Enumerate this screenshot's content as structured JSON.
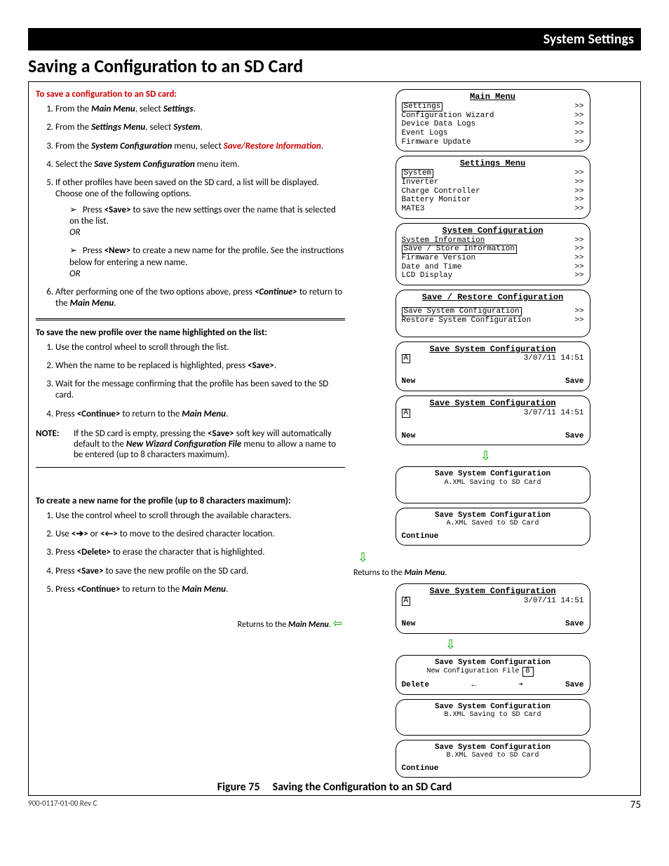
{
  "header": {
    "section": "System Settings"
  },
  "title": "Saving a Configuration to an SD Card",
  "sec1": {
    "heading": "To save a configuration to an SD card:",
    "s1a": "From the ",
    "s1b": "Main Menu",
    "s1c": ", select ",
    "s1d": "Settings",
    "s1e": ".",
    "s2a": "From the ",
    "s2b": "Settings Menu",
    "s2c": ", select ",
    "s2d": "System",
    "s2e": ".",
    "s3a": "From the ",
    "s3b": "System Configuration",
    "s3c": " menu, select ",
    "s3d": "Save/Restore Information",
    "s3e": ".",
    "s4a": "Select the ",
    "s4b": "Save System Configuration",
    "s4c": " menu item.",
    "s5": "If other profiles have been saved on the SD card, a list will be displayed.  Choose one of the following options.",
    "s5sub1a": "Press ",
    "s5sub1b": "<Save>",
    "s5sub1c": " to save the new settings over the name that is selected on the list.",
    "or": "OR",
    "s5sub2a": "Press ",
    "s5sub2b": "<New>",
    "s5sub2c": " to create a new name for the profile. See the instructions below for entering a new name.",
    "s6a": "After performing one of the two options above, press ",
    "s6b": "<Continue>",
    "s6c": " to return to the ",
    "s6d": "Main Menu",
    "s6e": "."
  },
  "sec2": {
    "heading": "To save the new profile over the name highlighted on the list:",
    "s1": "Use the control wheel to scroll through the list.",
    "s2a": "When the name to be replaced is highlighted, press ",
    "s2b": "<Save>",
    "s2c": ".",
    "s3": "Wait for the message confirming that the profile has been saved to the SD card.",
    "s4a": "Press ",
    "s4b": "<Continue>",
    "s4c": " to return to the ",
    "s4d": "Main Menu",
    "s4e": ".",
    "noteLabel": "NOTE:",
    "n1": "If the SD card is empty, pressing the ",
    "n2": "<Save>",
    "n3": " soft key will automatically default to the ",
    "n4": "New Wizard Configuration File",
    "n5": " menu to allow a name to be entered (up to 8 characters maximum)."
  },
  "sec3": {
    "heading": "To create a new name for the profile (up to 8 characters maximum):",
    "s1": "Use the control wheel to scroll through the available characters.",
    "s2a": "Use ",
    "s2b": "<➔>",
    "s2c": " or ",
    "s2d": "<←>",
    "s2e": " to move to the desired character location.",
    "s3a": "Press ",
    "s3b": "<Delete>",
    "s3c": " to erase the character that is highlighted.",
    "s4a": "Press ",
    "s4b": "<Save>",
    "s4c": " to save the new profile  on the SD card.",
    "s5a": "Press ",
    "s5b": "<Continue>",
    "s5c": " to return to the ",
    "s5d": "Main Menu",
    "s5e": "."
  },
  "lcd": {
    "mainMenu": {
      "title": "Main Menu",
      "sel": "Settings",
      "items": [
        "Configuration Wizard",
        "Device Data Logs",
        "Event Logs",
        "Firmware Update"
      ],
      "gt": ">>"
    },
    "settingsMenu": {
      "title": "Settings Menu",
      "sel": "System",
      "items": [
        "Inverter",
        "Charge Controller",
        "Battery Monitor",
        "MATE3"
      ],
      "gt": ">>"
    },
    "sysConfig": {
      "title": "System Configuration",
      "top": "System Information",
      "sel": "Save / Store Information",
      "items": [
        "Firmware Version",
        "Date and Time",
        "LCD Display"
      ],
      "gt": ">>"
    },
    "saveRestore": {
      "title": "Save / Restore Configuration",
      "sel": "Save System Configuration",
      "line2": "Restore System Configuration",
      "gt": ">>"
    },
    "ssc": {
      "title": "Save System Configuration",
      "letterA": "A",
      "date": "3/07/11  14:51",
      "new": "New",
      "save": "Save"
    },
    "saving": {
      "title": "Save System Configuration",
      "msg": "A.XML Saving to SD Card"
    },
    "saved": {
      "title": "Save System Configuration",
      "msg": "A.XML Saved to SD Card",
      "cont": "Continue"
    },
    "newFile": {
      "title": "Save System Configuration",
      "label": "New Configuration File",
      "letterB": "B",
      "delete": "Delete",
      "left": "←",
      "right": "➔",
      "save": "Save"
    },
    "savingB": {
      "title": "Save System Configuration",
      "msg": "B.XML Saving to SD Card"
    },
    "savedB": {
      "title": "Save System Configuration",
      "msg": "B.XML Saved to SD Card",
      "cont": "Continue"
    }
  },
  "returnsText": {
    "a": "Returns to the ",
    "b": "Main Menu",
    "c": "."
  },
  "figure": {
    "num": "Figure 75",
    "title": "Saving the Configuration to an SD Card"
  },
  "footer": {
    "doc": "900-0117-01-00 Rev C",
    "page": "75"
  }
}
